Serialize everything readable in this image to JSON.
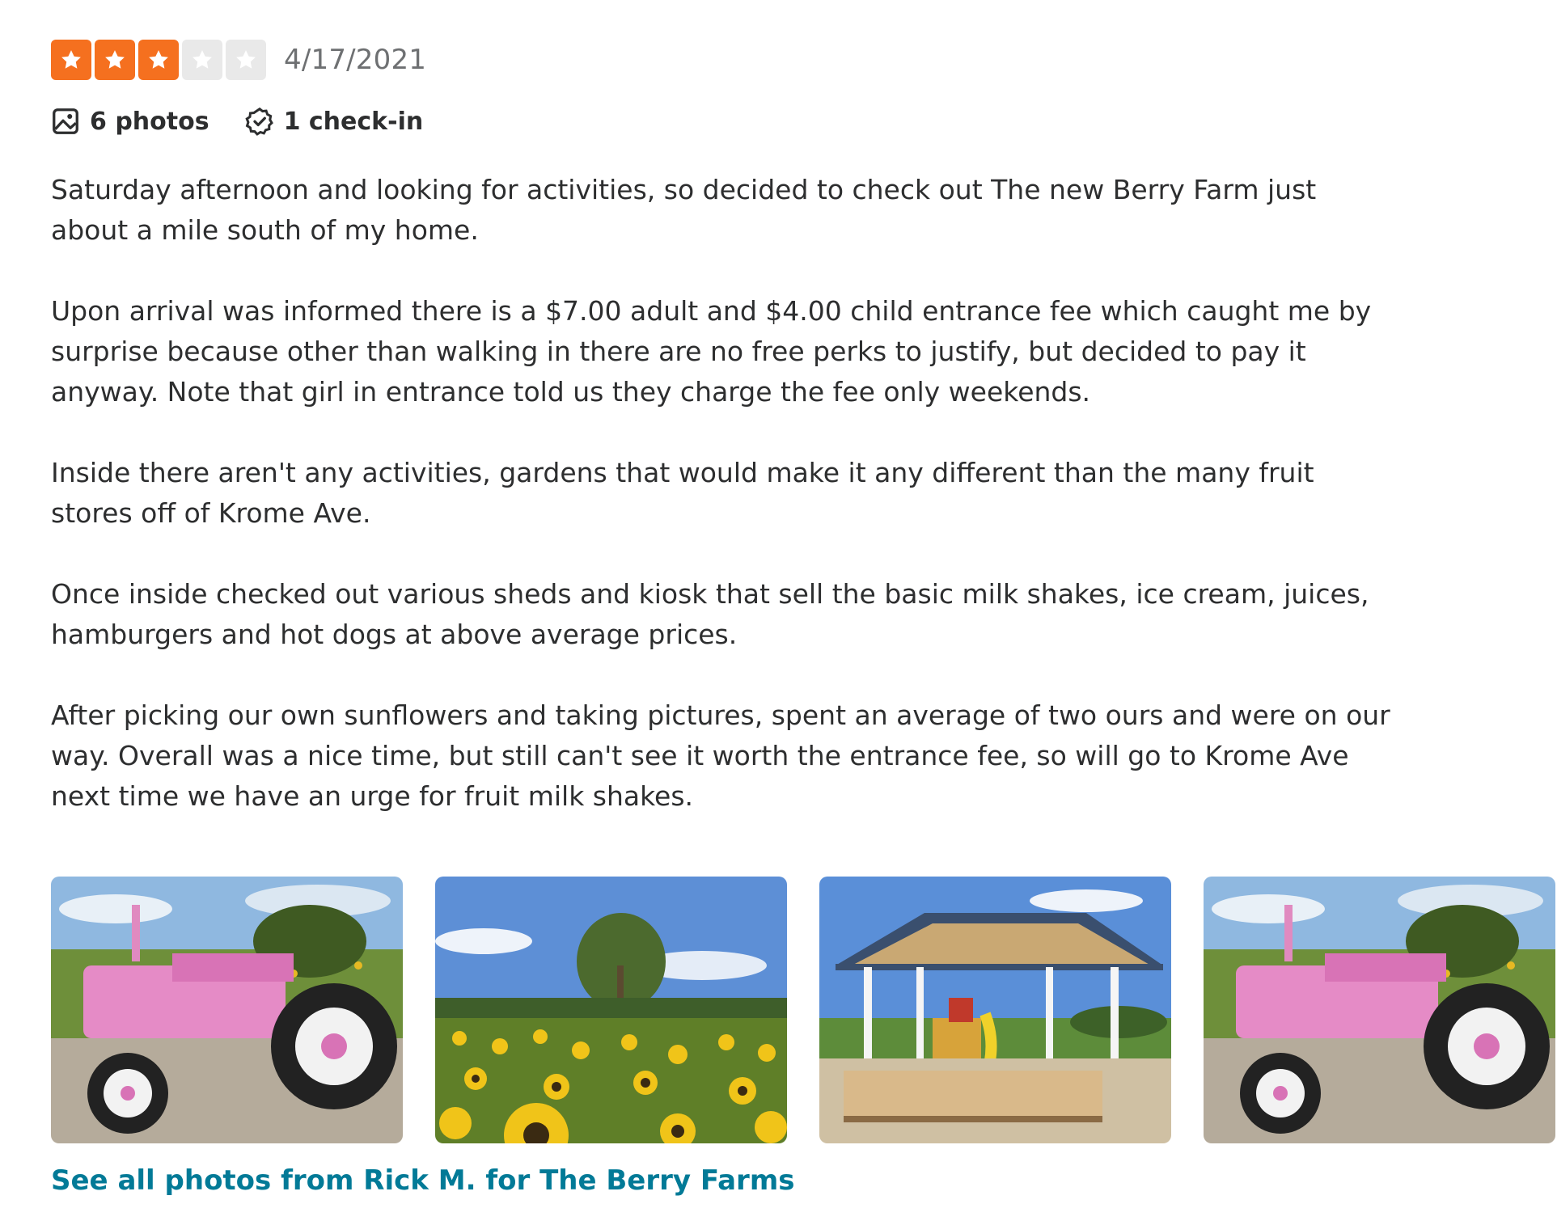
{
  "review": {
    "rating": 3,
    "rating_max": 5,
    "date": "4/17/2021",
    "star_filled_color": "#f5701f",
    "star_empty_color": "#e9e9e9",
    "photos_label": "6 photos",
    "checkin_label": "1 check-in",
    "paragraphs": [
      "Saturday afternoon and looking for activities, so decided to check out The new Berry Farm just about a mile south of my home.",
      "Upon arrival was informed there is a $7.00 adult and $4.00 child entrance fee which caught me by surprise because other than walking in there are no free perks to justify, but decided to pay it anyway. Note that girl in entrance told us they charge the fee only weekends.",
      "Inside there aren't any activities, gardens that would make it any different than the many fruit stores off of Krome Ave.",
      "Once inside checked out various sheds and kiosk that sell the basic milk shakes, ice cream, juices, hamburgers and hot dogs at above average prices.",
      "After picking our own sunflowers and taking pictures, spent an average of two ours and were on our way. Overall was a nice time, but still can't see it worth the entrance fee, so will go to Krome Ave next time we have an urge for fruit milk shakes."
    ],
    "photo_items": [
      {
        "name": "photo-pink-tractor"
      },
      {
        "name": "photo-sunflower-field"
      },
      {
        "name": "photo-playground-pavilion"
      },
      {
        "name": "photo-pink-tractor-2"
      }
    ],
    "see_all_link": "See all photos from Rick M. for The Berry Farms",
    "link_color": "#027a97"
  }
}
